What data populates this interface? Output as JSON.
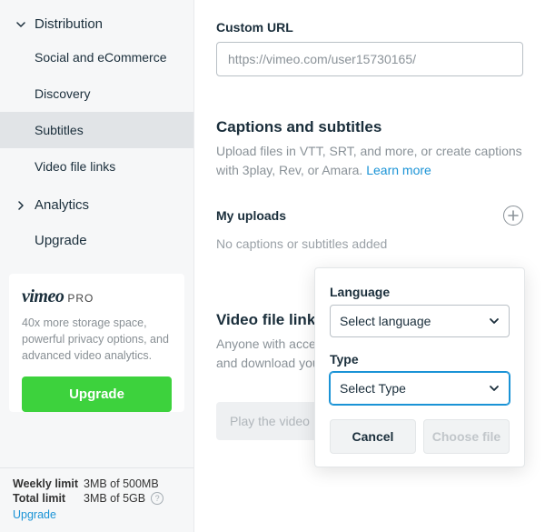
{
  "sidebar": {
    "sections": [
      {
        "label": "Distribution",
        "expanded": true,
        "children": [
          {
            "label": "Social and eCommerce",
            "selected": false
          },
          {
            "label": "Discovery",
            "selected": false
          },
          {
            "label": "Subtitles",
            "selected": true
          },
          {
            "label": "Video file links",
            "selected": false
          }
        ]
      },
      {
        "label": "Analytics",
        "expanded": false,
        "children": []
      }
    ],
    "upgrade_label": "Upgrade",
    "promo": {
      "logo_brand": "vimeo",
      "logo_tier": "PRO",
      "text": "40x more storage space, powerful privacy options, and advanced video analytics.",
      "cta": "Upgrade"
    },
    "footer": {
      "weekly_label": "Weekly limit",
      "weekly_value": "3MB of 500MB",
      "total_label": "Total limit",
      "total_value": "3MB of 5GB",
      "upgrade": "Upgrade"
    }
  },
  "main": {
    "custom_url_label": "Custom URL",
    "custom_url_value": "https://vimeo.com/user15730165/",
    "captions": {
      "heading": "Captions and subtitles",
      "desc": "Upload files in VTT, SRT, and more, or create captions with 3play, Rev, or Amara. ",
      "learn_more": "Learn more"
    },
    "uploads": {
      "heading": "My uploads",
      "empty": "No captions or subtitles added"
    },
    "vfl": {
      "heading": "Video file links",
      "desc": "Anyone with access to these links will be able to play and download your video.",
      "play_placeholder": "Play the video"
    }
  },
  "popover": {
    "language_label": "Language",
    "language_value": "Select language",
    "type_label": "Type",
    "type_value": "Select Type",
    "cancel": "Cancel",
    "choose": "Choose file"
  }
}
